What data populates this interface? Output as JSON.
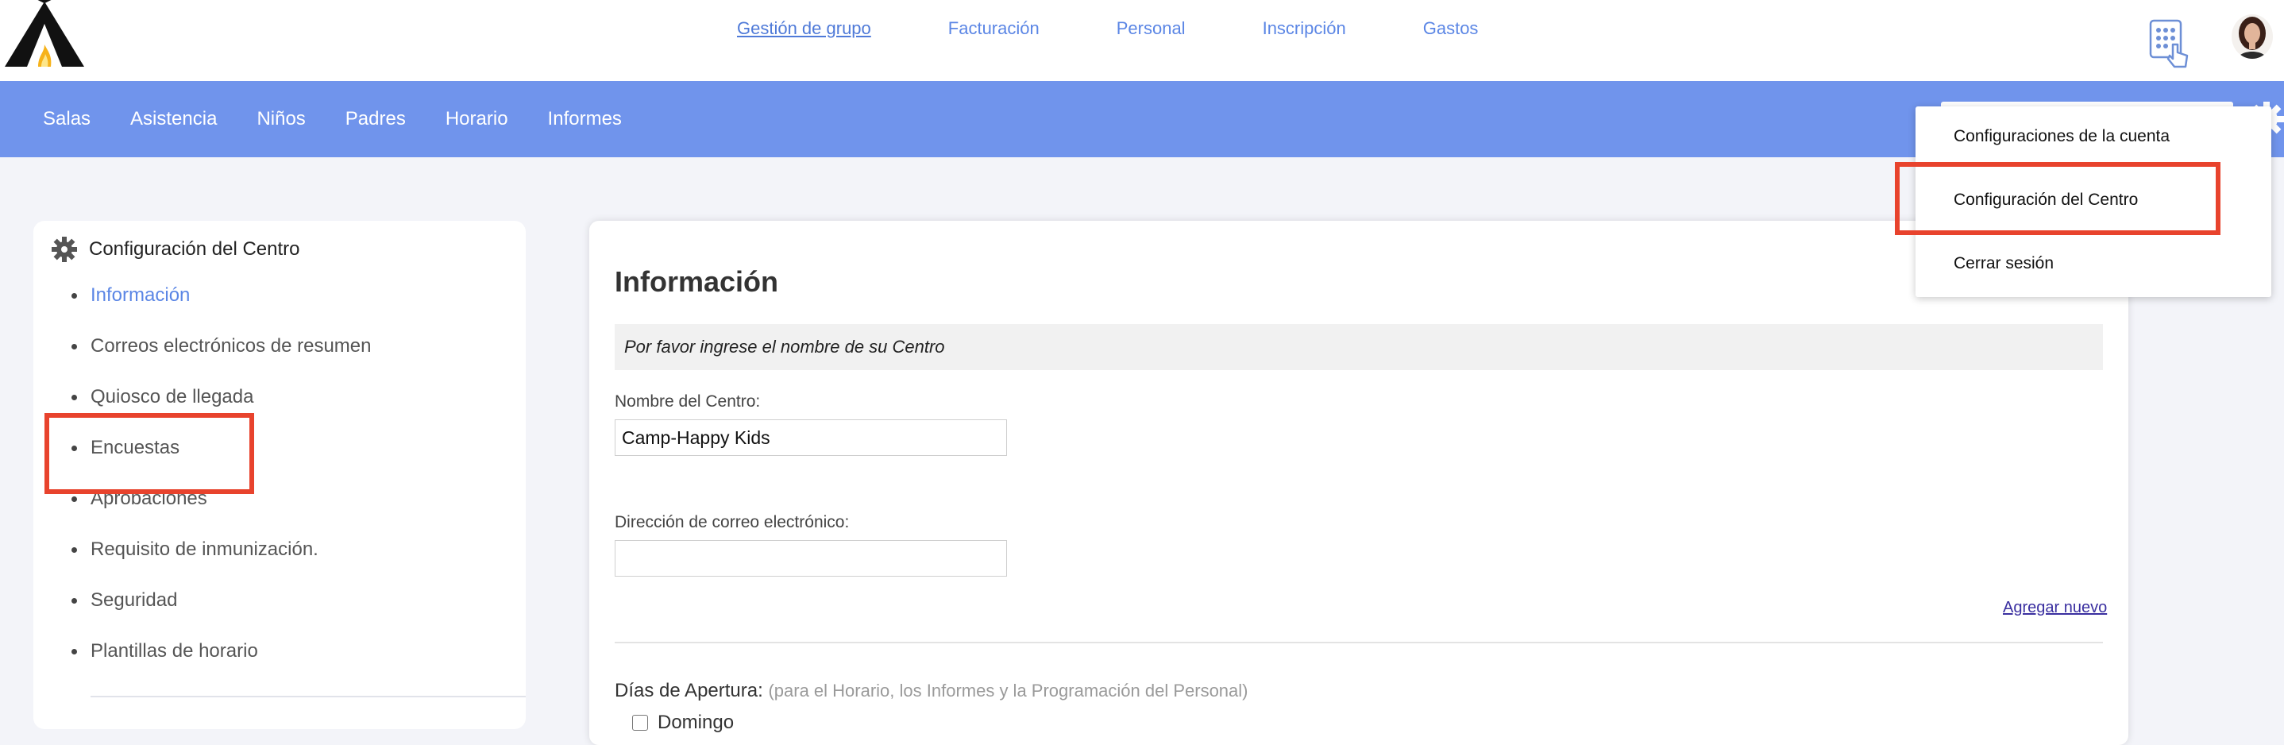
{
  "header": {
    "nav": [
      "Gestión de grupo",
      "Facturación",
      "Personal",
      "Inscripción",
      "Gastos"
    ],
    "active_nav": "Gestión de grupo",
    "logo_icon": "tent-logo-icon",
    "kiosk_icon": "keypad-touch-icon",
    "avatar_icon": "user-avatar"
  },
  "subnav": {
    "items": [
      "Salas",
      "Asistencia",
      "Niños",
      "Padres",
      "Horario",
      "Informes"
    ],
    "background": "#7094ec"
  },
  "sidebar": {
    "title": "Configuración del Centro",
    "items": [
      "Información",
      "Correos electrónicos de resumen",
      "Quiosco de llegada",
      "Encuestas",
      "Aprobaciones",
      "Requisito de inmunización.",
      "Seguridad",
      "Plantillas de horario"
    ],
    "active_item": "Información"
  },
  "main": {
    "title": "Información",
    "notice": "Por favor ingrese el nombre de su Centro",
    "center_name_label": "Nombre del Centro:",
    "center_name_value": "Camp-Happy Kids",
    "email_label": "Dirección de correo electrónico:",
    "email_value": "",
    "add_new": "Agregar nuevo",
    "days_label": "Días de Apertura:",
    "days_hint": "(para el Horario, los Informes y la Programación del Personal)",
    "first_day": "Domingo"
  },
  "dropdown": {
    "items": [
      "Configuraciones de la cuenta",
      "Configuración del Centro",
      "Cerrar sesión"
    ]
  },
  "colors": {
    "accent": "#5b86e5",
    "highlight": "#e8432d",
    "link_visited": "#3a2fa0"
  }
}
